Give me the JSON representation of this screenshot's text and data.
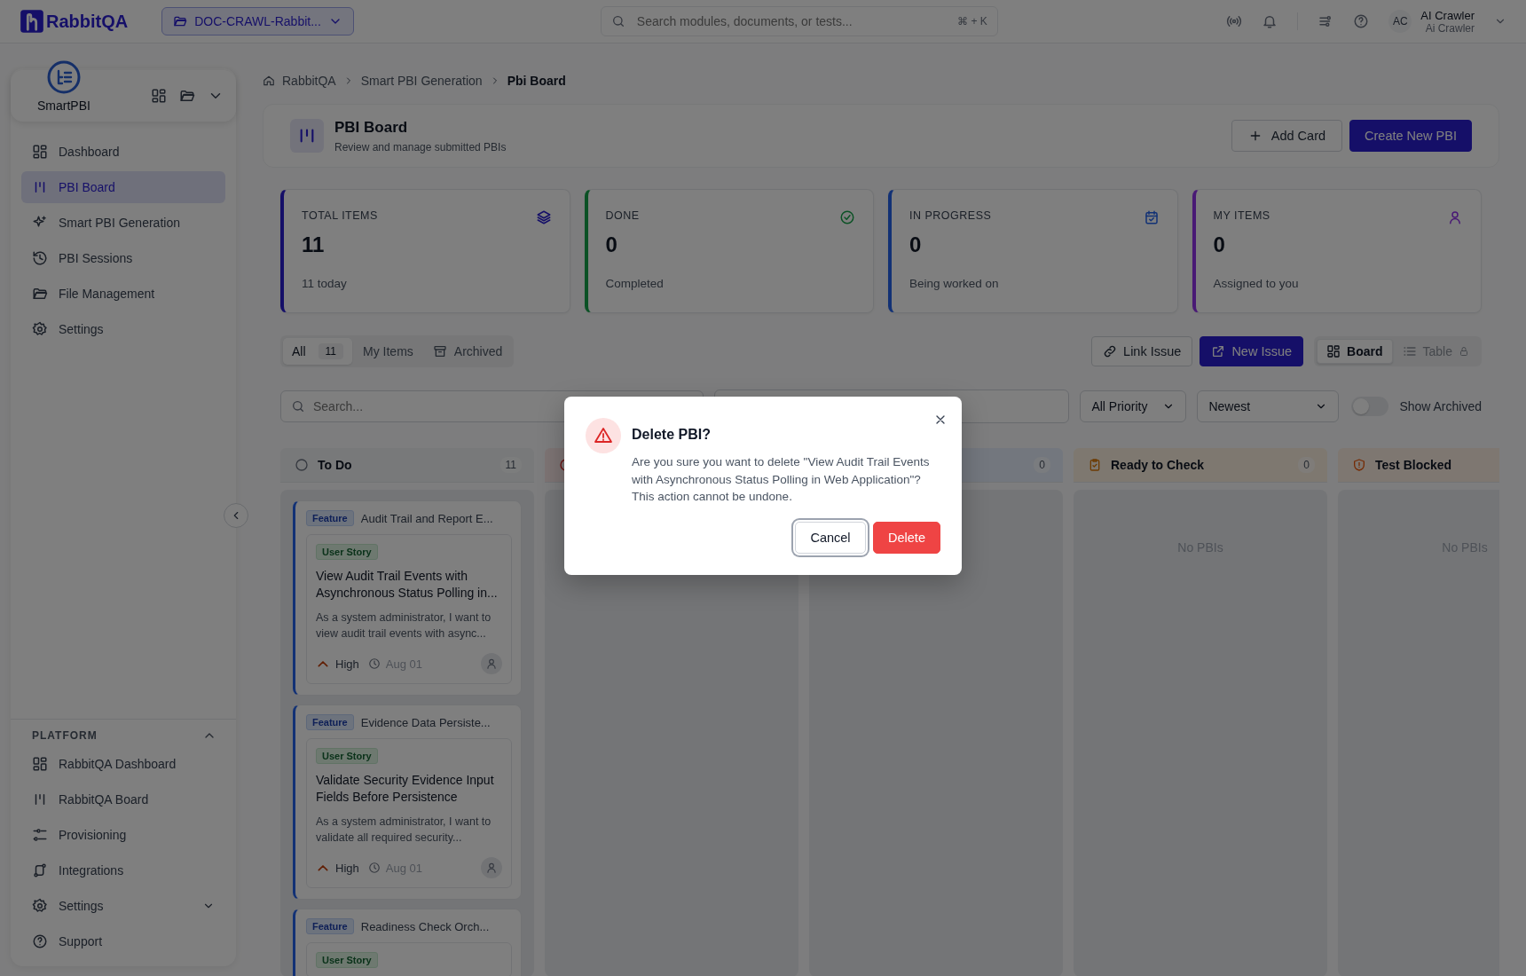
{
  "topbar": {
    "logo": "RabbitQA",
    "project": "DOC-CRAWL-Rabbit...",
    "search": {
      "placeholder": "Search modules, documents, or tests...",
      "shortcut": "⌘ + K"
    },
    "avatar": "AC",
    "user_name": "AI Crawler",
    "user_sub": "Ai Crawler"
  },
  "sidebar": {
    "module": "SmartPBI",
    "items": [
      {
        "label": "Dashboard",
        "selected": false
      },
      {
        "label": "PBI Board",
        "selected": true
      },
      {
        "label": "Smart PBI Generation",
        "selected": false
      },
      {
        "label": "PBI Sessions",
        "selected": false
      },
      {
        "label": "File Management",
        "selected": false
      },
      {
        "label": "Settings",
        "selected": false
      }
    ],
    "platform": {
      "title": "PLATFORM",
      "expanded": true,
      "items": [
        {
          "label": "RabbitQA Dashboard",
          "kind": "link"
        },
        {
          "label": "RabbitQA Board",
          "kind": "link"
        },
        {
          "label": "Provisioning",
          "kind": "link"
        },
        {
          "label": "Integrations",
          "kind": "link"
        },
        {
          "label": "Settings",
          "kind": "group",
          "expanded": false
        },
        {
          "label": "Support",
          "kind": "link"
        }
      ]
    }
  },
  "breadcrumb": [
    "RabbitQA",
    "Smart PBI Generation",
    "Pbi Board"
  ],
  "header": {
    "title": "PBI Board",
    "subtitle": "Review and manage submitted PBIs",
    "buttons": [
      {
        "label": "Add Card",
        "kind": "secondary"
      },
      {
        "label": "Create New PBI",
        "kind": "primary"
      }
    ]
  },
  "stats": [
    {
      "label": "TOTAL ITEMS",
      "value": "11",
      "note": "11 today"
    },
    {
      "label": "DONE",
      "value": "0",
      "note": "Completed"
    },
    {
      "label": "IN PROGRESS",
      "value": "0",
      "note": "Being worked on"
    },
    {
      "label": "MY ITEMS",
      "value": "0",
      "note": "Assigned to you"
    }
  ],
  "tabs": [
    {
      "label": "All",
      "count": "11",
      "selected": true
    },
    {
      "label": "My Items",
      "selected": false
    },
    {
      "label": "Archived",
      "selected": false
    }
  ],
  "actions": [
    {
      "label": "Link Issue",
      "kind": "secondary"
    },
    {
      "label": "New Issue",
      "kind": "primary"
    }
  ],
  "views": [
    {
      "label": "Board",
      "selected": true,
      "disabled": false
    },
    {
      "label": "Table",
      "selected": false,
      "disabled": true
    }
  ],
  "filters": {
    "search_placeholder": "Search...",
    "priority": "All Priority",
    "sort": "Newest",
    "show_archived": {
      "label": "Show Archived",
      "on": false
    }
  },
  "columns": [
    {
      "kind": "open",
      "title": "To Do",
      "count": "11",
      "cards": [
        {
          "feature_tag": "Feature",
          "feature": "Audit Trail and Report E...",
          "story_tag": "User Story",
          "title": "View Audit Trail Events with Asynchronous Status Polling in...",
          "description": "As a system administrator, I want to view audit trail events with async...",
          "priority": "High",
          "date": "Aug 01"
        },
        {
          "feature_tag": "Feature",
          "feature": "Evidence Data Persiste...",
          "story_tag": "User Story",
          "title": "Validate Security Evidence Input Fields Before Persistence",
          "description": "As a system administrator, I want to validate all required security...",
          "priority": "High",
          "date": "Aug 01"
        },
        {
          "feature_tag": "Feature",
          "feature": "Readiness Check Orch...",
          "story_tag": "User Story"
        }
      ]
    },
    {
      "kind": "alert"
    },
    {
      "kind": "plain",
      "count": "0"
    },
    {
      "kind": "check",
      "title": "Ready to Check",
      "count": "0",
      "empty": "No PBIs"
    },
    {
      "kind": "blocked",
      "title": "Test Blocked",
      "empty": "No PBIs"
    }
  ],
  "dialog": {
    "title": "Delete PBI?",
    "message": "Are you sure you want to delete \"View Audit Trail Events with Asynchronous Status Polling in Web Application\"? This action cannot be undone.",
    "buttons": [
      {
        "label": "Cancel",
        "kind": "secondary",
        "focused": true
      },
      {
        "label": "Delete",
        "kind": "danger",
        "focused": false
      }
    ]
  }
}
